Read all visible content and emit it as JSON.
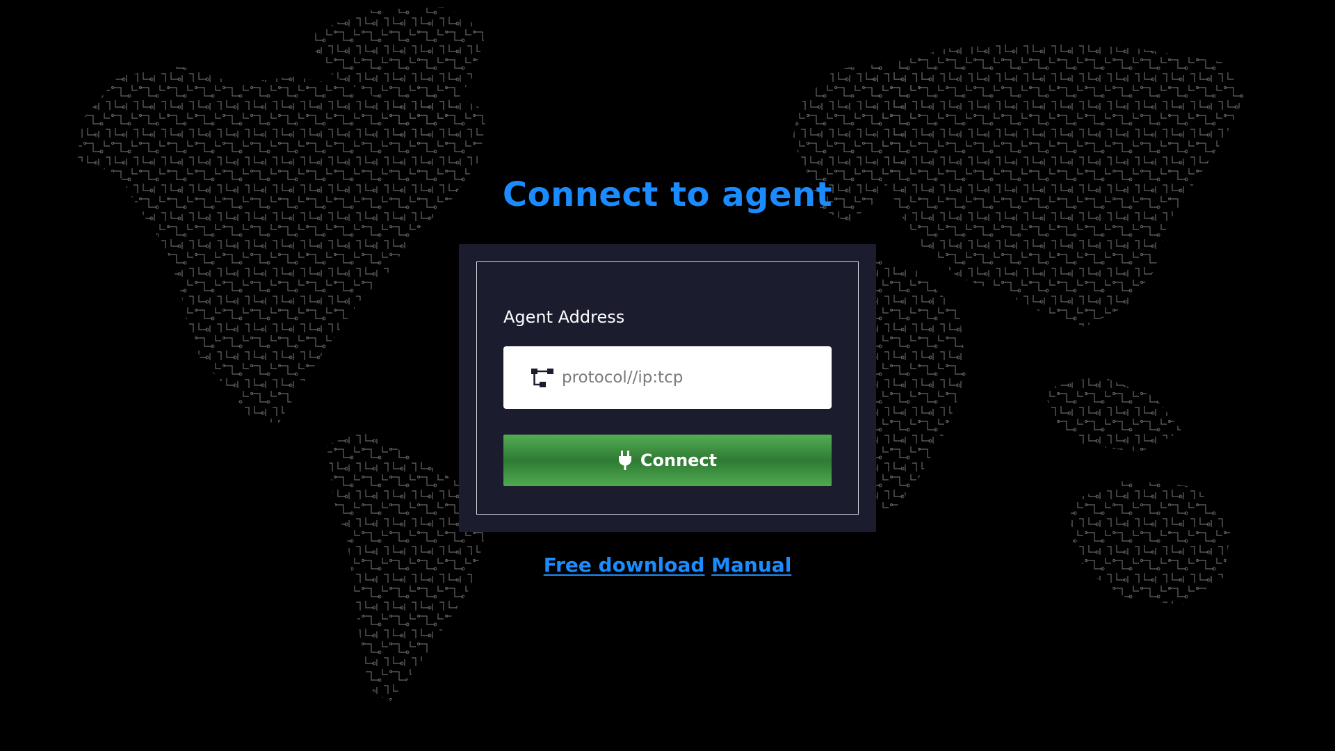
{
  "page": {
    "title": "Connect to agent",
    "background_icon": "world-circuit-map"
  },
  "form": {
    "address_label": "Agent Address",
    "address_placeholder": "protocol//ip:tcp",
    "address_value": "",
    "address_icon": "network-nodes-icon",
    "connect_label": "Connect",
    "connect_icon": "plug-icon"
  },
  "links": {
    "download": "Free download",
    "manual": "Manual"
  },
  "colors": {
    "accent": "#1a8cff",
    "panel": "#1b1d2f",
    "connect_button": "#3f9444",
    "background": "#000000",
    "circuit_lines": "#6c6c6c"
  }
}
